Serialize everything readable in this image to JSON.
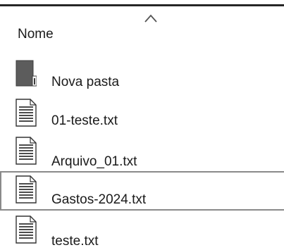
{
  "column": {
    "name_label": "Nome",
    "sort_icon": "chevron-up-icon"
  },
  "files": [
    {
      "name": "Nova pasta",
      "type": "folder",
      "icon": "folder-icon",
      "selected": false
    },
    {
      "name": "01-teste.txt",
      "type": "text-file",
      "icon": "text-file-icon",
      "selected": false
    },
    {
      "name": "Arquivo_01.txt",
      "type": "text-file",
      "icon": "text-file-icon",
      "selected": false
    },
    {
      "name": "Gastos-2024.txt",
      "type": "text-file",
      "icon": "text-file-icon",
      "selected": true
    },
    {
      "name": "teste.txt",
      "type": "text-file",
      "icon": "text-file-icon",
      "selected": false
    }
  ]
}
